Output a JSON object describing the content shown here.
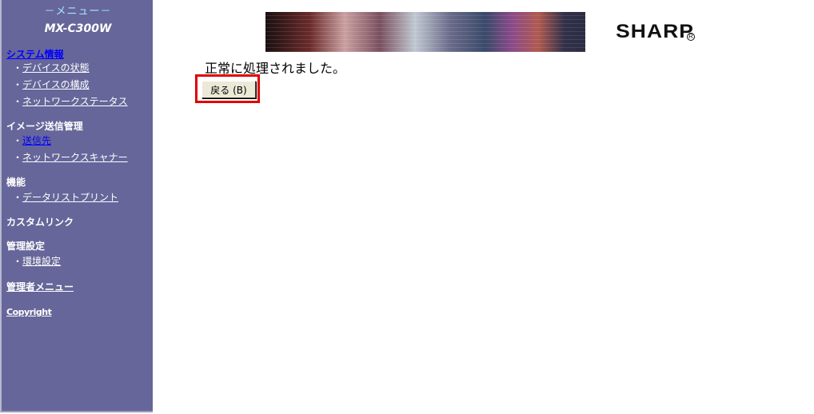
{
  "sidebar": {
    "menu_title": "－メニュー－",
    "model": "MX-C300W",
    "sections": {
      "system_info": {
        "title": "システム情報",
        "items": [
          "デバイスの状態",
          "デバイスの構成",
          "ネットワークステータス"
        ]
      },
      "image_send": {
        "title": "イメージ送信管理",
        "items": [
          "送信先",
          "ネットワークスキャナー"
        ]
      },
      "functions": {
        "title": "機能",
        "items": [
          "データリストプリント"
        ]
      },
      "custom_link": {
        "title": "カスタムリンク"
      },
      "admin_settings": {
        "title": "管理設定",
        "items": [
          "環境設定"
        ]
      },
      "admin_menu": {
        "title": "管理者メニュー"
      },
      "copyright": {
        "title": "Copyright"
      }
    },
    "bullet": "・"
  },
  "banner": {
    "brand": "SHARP",
    "reg": "R"
  },
  "main": {
    "message": "正常に処理されました。",
    "back_button": "戻る (B)"
  },
  "colors": {
    "sidebar_bg": "#66669a",
    "menu_title": "#a9e6ff",
    "link": "#0000ff",
    "highlight": "#e00000"
  }
}
